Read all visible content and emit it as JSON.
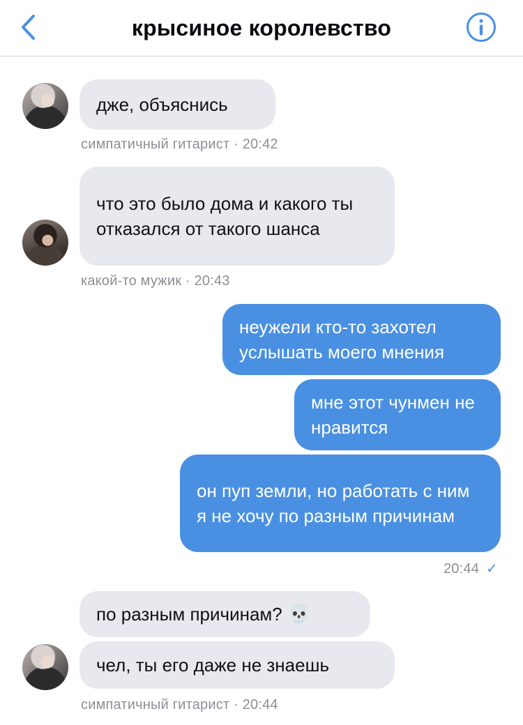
{
  "header": {
    "title": "крысиное королевство",
    "back_icon": "chevron-left-icon",
    "info_icon": "info-icon",
    "accent": "#4a90e2"
  },
  "messages": [
    {
      "dir": "in",
      "text": "дже, объяснись"
    },
    {
      "dir": "in",
      "text": "что это было дома и какого ты отказался от такого шанса"
    },
    {
      "dir": "out",
      "text": "неужели кто-то захотел услышать моего мнения"
    },
    {
      "dir": "out",
      "text": "мне этот чунмен не нравится"
    },
    {
      "dir": "out",
      "text": "он пуп земли, но работать с ним я не хочу по разным причинам"
    },
    {
      "dir": "in",
      "text": "по разным причинам?",
      "emoji": "💀"
    },
    {
      "dir": "in",
      "text": "чел, ты его даже не знаешь"
    }
  ],
  "meta": {
    "m1": "симпатичный гитарист · 20:42",
    "m2": "какой-то мужик · 20:43",
    "m3_time": "20:44",
    "m3_check": "✓",
    "m4": "симпатичный гитарист · 20:44"
  },
  "colors": {
    "incoming_bubble": "#e8e8ef",
    "outgoing_bubble": "#4a90e2",
    "meta_text": "#8e8e96"
  }
}
